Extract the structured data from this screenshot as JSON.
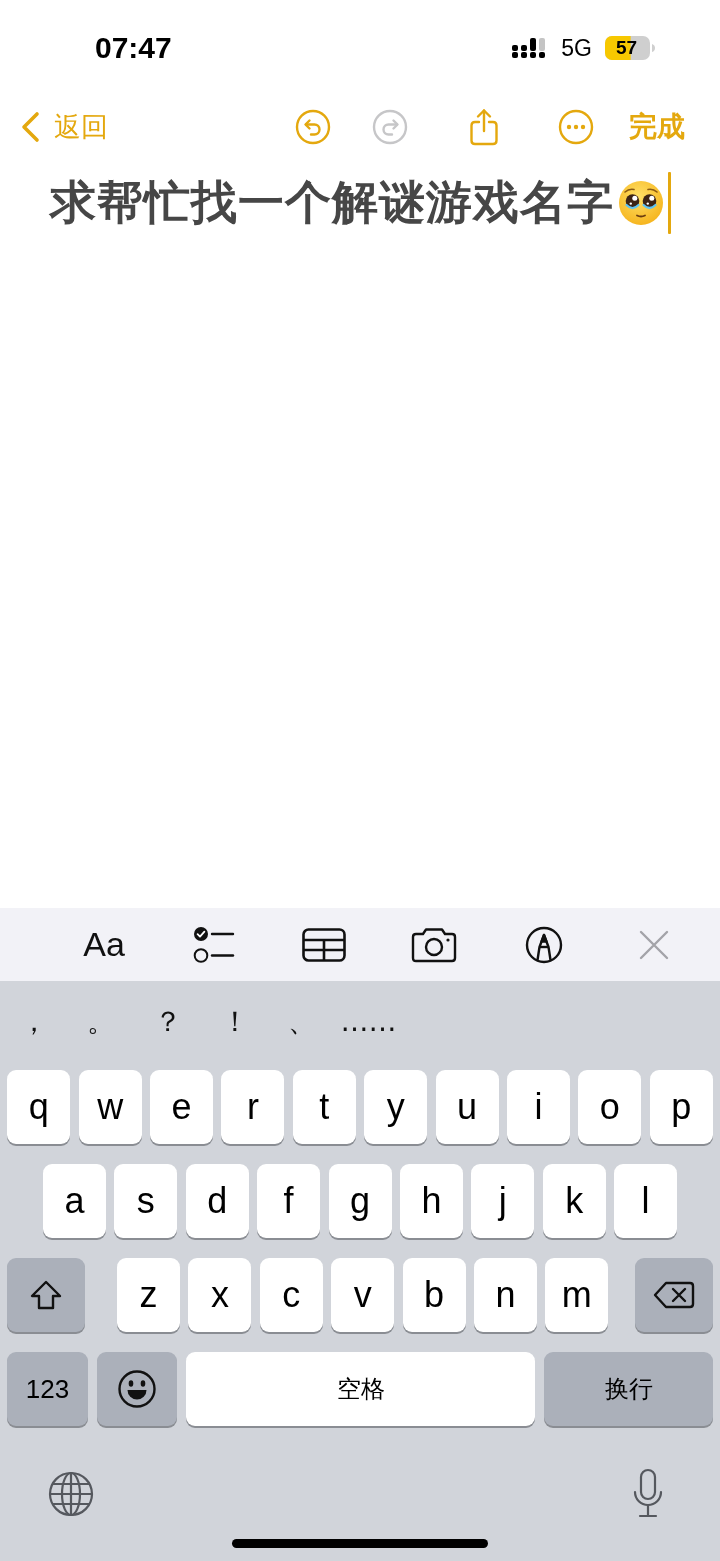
{
  "status_bar": {
    "time": "07:47",
    "network": "5G",
    "battery": "57",
    "low_power_mode": true
  },
  "nav_bar": {
    "back": "返回",
    "actions": [
      {
        "kind": "undo",
        "disabled": false
      },
      {
        "kind": "redo",
        "disabled": true
      },
      {
        "kind": "share",
        "disabled": false
      },
      {
        "kind": "more",
        "disabled": false
      }
    ],
    "done": "完成"
  },
  "note": {
    "title": "求帮忙找一个解谜游戏名字"
  },
  "format_toolbar": [
    {
      "kind": "text_style",
      "label": "Aa"
    },
    {
      "kind": "checklist"
    },
    {
      "kind": "table"
    },
    {
      "kind": "camera"
    },
    {
      "kind": "markup"
    },
    {
      "kind": "close"
    }
  ],
  "keyboard": {
    "suggestions": [
      "，",
      "。",
      "？",
      "！",
      "、",
      "……"
    ],
    "key_rows": [
      {
        "keys": [
          {
            "kind": "letter",
            "label": "q"
          },
          {
            "kind": "letter",
            "label": "w"
          },
          {
            "kind": "letter",
            "label": "e"
          },
          {
            "kind": "letter",
            "label": "r"
          },
          {
            "kind": "letter",
            "label": "t"
          },
          {
            "kind": "letter",
            "label": "y"
          },
          {
            "kind": "letter",
            "label": "u"
          },
          {
            "kind": "letter",
            "label": "i"
          },
          {
            "kind": "letter",
            "label": "o"
          },
          {
            "kind": "letter",
            "label": "p"
          }
        ]
      },
      {
        "keys": [
          {
            "kind": "letter",
            "label": "a"
          },
          {
            "kind": "letter",
            "label": "s"
          },
          {
            "kind": "letter",
            "label": "d"
          },
          {
            "kind": "letter",
            "label": "f"
          },
          {
            "kind": "letter",
            "label": "g"
          },
          {
            "kind": "letter",
            "label": "h"
          },
          {
            "kind": "letter",
            "label": "j"
          },
          {
            "kind": "letter",
            "label": "k"
          },
          {
            "kind": "letter",
            "label": "l"
          }
        ]
      },
      {
        "keys": [
          {
            "kind": "shift"
          },
          {
            "kind": "letter",
            "label": "z"
          },
          {
            "kind": "letter",
            "label": "x"
          },
          {
            "kind": "letter",
            "label": "c"
          },
          {
            "kind": "letter",
            "label": "v"
          },
          {
            "kind": "letter",
            "label": "b"
          },
          {
            "kind": "letter",
            "label": "n"
          },
          {
            "kind": "letter",
            "label": "m"
          },
          {
            "kind": "backspace"
          }
        ]
      },
      {
        "keys": [
          {
            "kind": "numbers",
            "label": "123"
          },
          {
            "kind": "emoji"
          },
          {
            "kind": "space",
            "label": "空格"
          },
          {
            "kind": "return",
            "label": "换行"
          }
        ]
      }
    ]
  }
}
